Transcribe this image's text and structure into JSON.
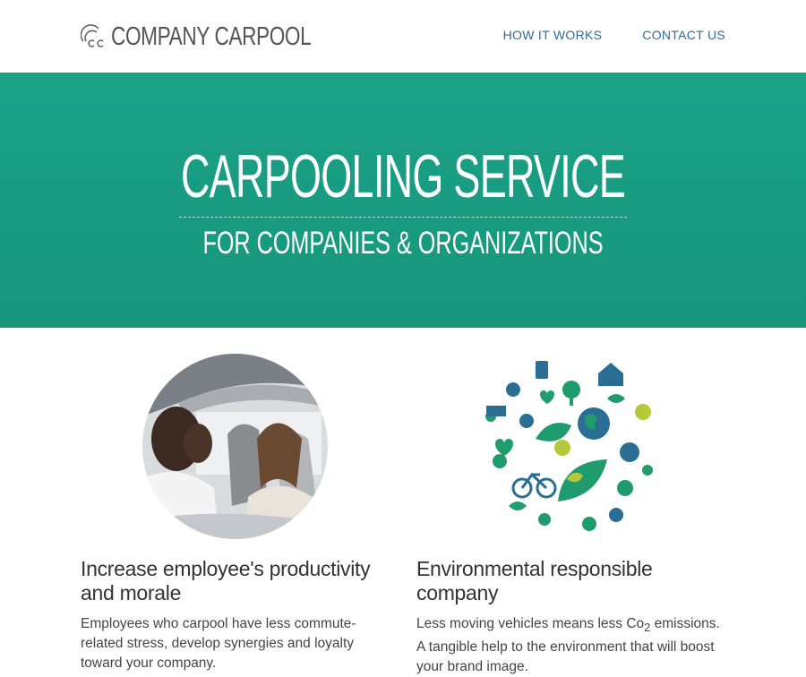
{
  "header": {
    "logo_text": "COMPANY CARPOOL",
    "nav": [
      "HOW IT WORKS",
      "CONTACT US"
    ]
  },
  "hero": {
    "title": "CARPOOLING SERVICE",
    "subtitle": "FOR COMPANIES & ORGANIZATIONS"
  },
  "features": [
    {
      "heading": "Increase employee's productivity and morale",
      "body": "Employees who carpool have less commute-related stress, develop synergies and loyalty toward your company."
    },
    {
      "heading": "Environmental responsible company",
      "body_pre": "Less moving vehicles means less Co",
      "body_sub": "2",
      "body_post": " emissions. A tangible help to the environment that will boost your brand image."
    }
  ],
  "colors": {
    "hero": "#1ba287",
    "nav": "#2f6b95",
    "eco_green": "#1f9b6e",
    "eco_blue": "#2a6f93"
  },
  "icons": [
    "logo-cc-icon",
    "people-in-car-photo",
    "eco-icons-circle"
  ]
}
